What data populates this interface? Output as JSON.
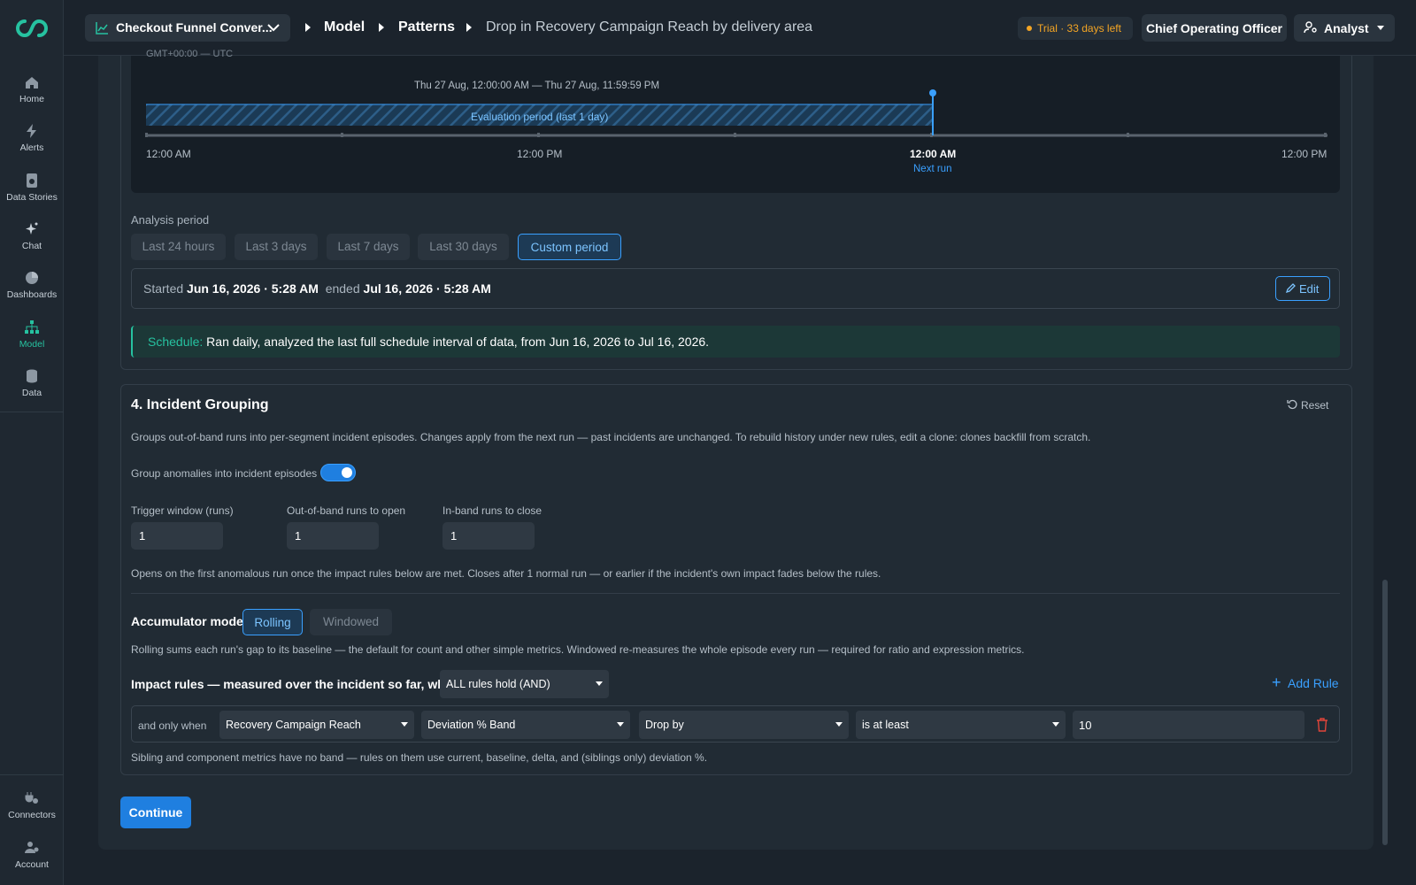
{
  "sidebar": {
    "items": [
      {
        "label": "Home",
        "icon": "home-icon"
      },
      {
        "label": "Alerts",
        "icon": "bolt-icon"
      },
      {
        "label": "Data Stories",
        "icon": "data-stories-icon"
      },
      {
        "label": "Chat",
        "icon": "sparkle-icon"
      },
      {
        "label": "Dashboards",
        "icon": "pie-icon"
      },
      {
        "label": "Model",
        "icon": "hierarchy-icon"
      },
      {
        "label": "Data",
        "icon": "database-icon"
      }
    ],
    "bottom": [
      {
        "label": "Connectors",
        "icon": "plug-icon"
      },
      {
        "label": "Account",
        "icon": "user-gear-icon"
      }
    ],
    "active_color": "#26c2a0"
  },
  "header": {
    "project": "Checkout Funnel Conver...",
    "crumbs": [
      "Model",
      "Patterns"
    ],
    "current": "Drop in Recovery Campaign Reach by delivery area",
    "trial": "Trial · 33 days left",
    "role": "Chief Operating Officer",
    "user": "Analyst"
  },
  "timeline": {
    "tz": "GMT+00:00 — UTC",
    "range": "Thu 27 Aug, 12:00:00 AM — Thu 27 Aug, 11:59:59 PM",
    "eval_label": "Evaluation period (last 1 day)",
    "ticks": [
      "12:00 AM",
      "12:00 PM",
      "12:00 AM",
      "12:00 PM"
    ],
    "next_run": "Next run"
  },
  "analysis": {
    "title": "Analysis period",
    "options": [
      "Last 24 hours",
      "Last 3 days",
      "Last 7 days",
      "Last 30 days",
      "Custom period"
    ],
    "selected": "Custom period",
    "started_label": "Started",
    "started": "Jun 16, 2026 · 5:28 AM",
    "ended_label": "ended",
    "ended": "Jul 16, 2026 · 5:28 AM",
    "edit": "Edit",
    "schedule_key": "Schedule:",
    "schedule_text": "Ran daily, analyzed the last full schedule interval of data, from Jun 16, 2026 to Jul 16, 2026."
  },
  "grouping": {
    "title": "4. Incident Grouping",
    "reset": "Reset",
    "desc": "Groups out-of-band runs into per-segment incident episodes. Changes apply from the next run — past incidents are unchanged. To rebuild history under new rules, edit a clone: clones backfill from scratch.",
    "toggle_label": "Group anomalies into incident episodes",
    "toggle_on": true,
    "fields": [
      {
        "label": "Trigger window (runs)",
        "value": "1"
      },
      {
        "label": "Out-of-band runs to open",
        "value": "1"
      },
      {
        "label": "In-band runs to close",
        "value": "1"
      }
    ],
    "note": "Opens on the first anomalous run once the impact rules below are met. Closes after 1 normal run — or earlier if the incident's own impact fades below the rules.",
    "acc_label": "Accumulator mode",
    "acc_options": [
      "Rolling",
      "Windowed"
    ],
    "acc_selected": "Rolling",
    "acc_desc": "Rolling sums each run's gap to its baseline — the default for count and other simple metrics. Windowed re-measures the whole episode every run — required for ratio and expression metrics.",
    "impact_title": "Impact rules — measured over the incident so far, when",
    "impact_mode": "ALL rules hold (AND)",
    "add_rule": "Add Rule",
    "rule": {
      "prefix": "and only when",
      "metric": "Recovery Campaign Reach",
      "measure": "Deviation % Band",
      "direction": "Drop by",
      "comparator": "is at least",
      "value": "10"
    },
    "footnote": "Sibling and component metrics have no band — rules on them use current, baseline, delta, and (siblings only) deviation %."
  },
  "continue": "Continue"
}
